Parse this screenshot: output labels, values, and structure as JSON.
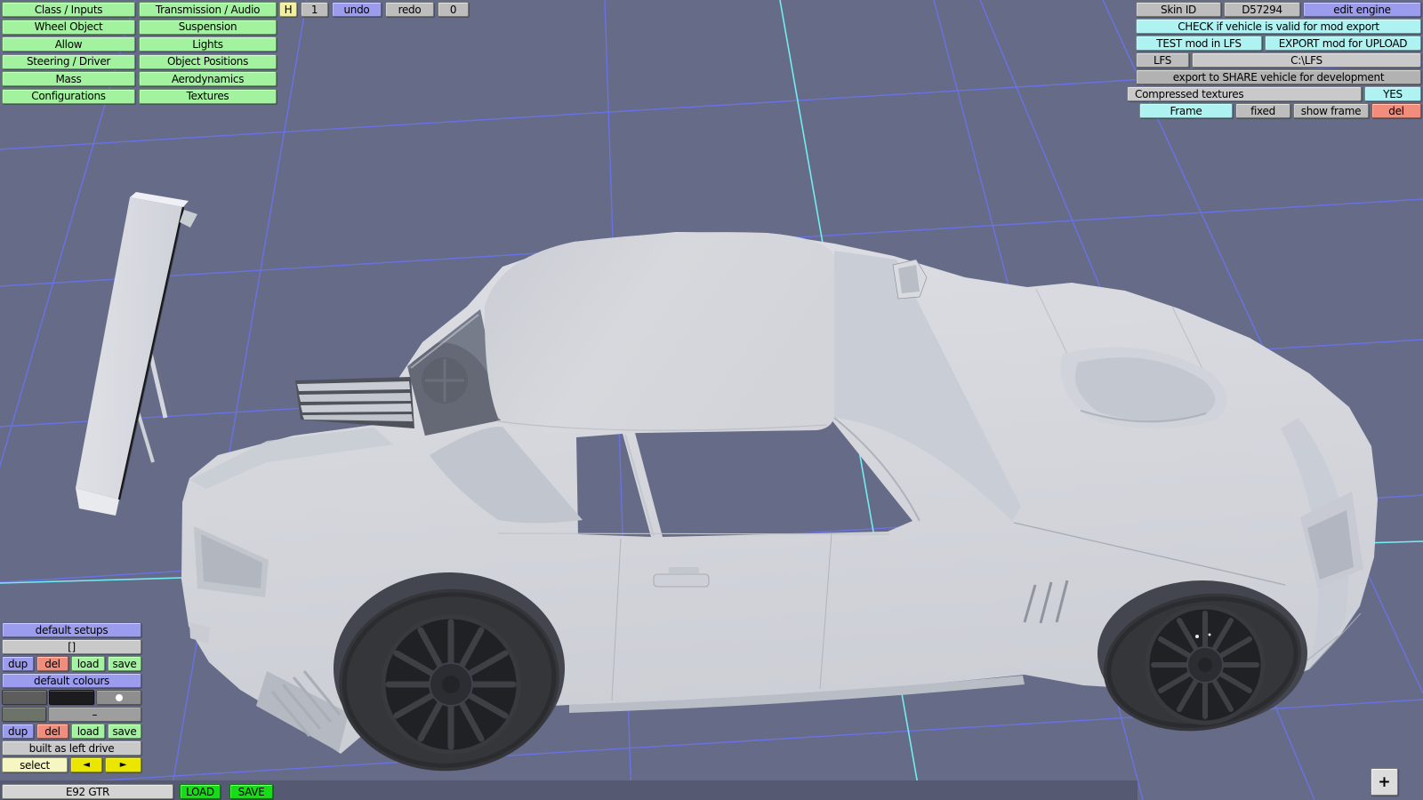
{
  "left_menu": {
    "items": [
      "Class / Inputs",
      "Transmission / Audio",
      "Wheel Object",
      "Suspension",
      "Allow",
      "Lights",
      "Steering / Driver",
      "Object Positions",
      "Mass",
      "Aerodynamics",
      "Configurations",
      "Textures"
    ]
  },
  "topbar": {
    "h": "H",
    "h_count": "1",
    "undo": "undo",
    "redo": "redo",
    "redo_count": "0"
  },
  "export_panel": {
    "skin_id_label": "Skin ID",
    "skin_id_value": "D57294",
    "edit_engine": "edit engine",
    "check": "CHECK if vehicle is valid for mod export",
    "test": "TEST mod in LFS",
    "export_upload": "EXPORT mod for UPLOAD",
    "lfs": "LFS",
    "lfs_path": "C:\\LFS",
    "share": "export to SHARE vehicle for development",
    "compressed": "Compressed textures",
    "compressed_value": "YES",
    "frame": "Frame",
    "fixed": "fixed",
    "show_frame": "show frame",
    "del": "del"
  },
  "setups_panel": {
    "header": "default setups",
    "setup_name": "[]",
    "dup": "dup",
    "del": "del",
    "load": "load",
    "save": "save"
  },
  "colours_panel": {
    "header": "default colours",
    "swatches_row1": [
      "#5d5d5d",
      "#1c1c1e",
      "#8e8e8e"
    ],
    "swatches_row2": [
      "#6e7369",
      "#9e9e9e"
    ],
    "dash": "–",
    "dup": "dup",
    "del": "del",
    "load": "load",
    "save": "save",
    "built": "built as left drive",
    "select": "select",
    "prev": "◄",
    "next": "►"
  },
  "bottom_bar": {
    "vehicle_name": "E92 GTR",
    "load": "LOAD",
    "save": "SAVE",
    "plus": "+"
  },
  "colors": {
    "viewport_bg": "#666b88",
    "grid_blue": "#6a73e9",
    "grid_cyan": "#70eef2",
    "button_green": "#a3f2a0",
    "button_cyan": "#aef2f2",
    "button_purple": "#9c9cef",
    "button_salmon": "#f28d7d",
    "button_yellow": "#f0f0a0",
    "bright_green": "#17dc17",
    "bottom_strip": "#555971",
    "car_body": "#d5d7dc",
    "tire_dark": "#35363a"
  }
}
